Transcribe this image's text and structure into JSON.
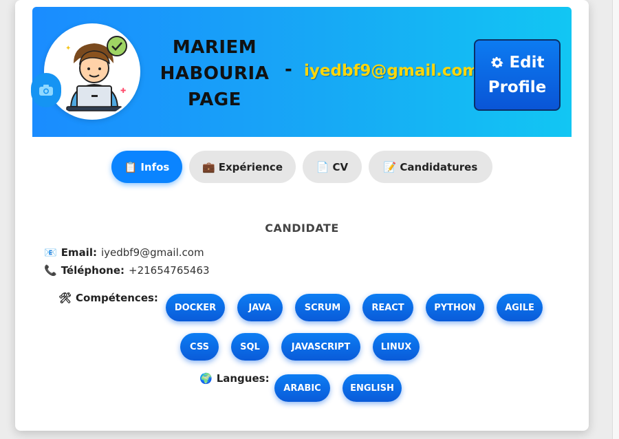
{
  "profile": {
    "name_line1": "MARIEM",
    "name_line2": "HABOURIA",
    "name_line3": "PAGE",
    "separator": "-",
    "email": "iyedbf9@gmail.com",
    "edit_line1": "Edit",
    "edit_line2": "Profile"
  },
  "tabs": [
    {
      "label": "Infos",
      "icon": "clipboard-icon",
      "active": true
    },
    {
      "label": "Expérience",
      "icon": "briefcase-icon",
      "active": false
    },
    {
      "label": "CV",
      "icon": "document-icon",
      "active": false
    },
    {
      "label": "Candidatures",
      "icon": "memo-icon",
      "active": false
    }
  ],
  "info": {
    "role": "CANDIDATE",
    "email_label": "Email:",
    "email_value": "iyedbf9@gmail.com",
    "phone_label": "Téléphone:",
    "phone_value": "+21654765463",
    "skills_label": "Compétences:",
    "skills": [
      "DOCKER",
      "JAVA",
      "SCRUM",
      "REACT",
      "PYTHON",
      "AGILE",
      "CSS",
      "SQL",
      "JAVASCRIPT",
      "LINUX"
    ],
    "languages_label": "Langues:",
    "languages": [
      "ARABIC",
      "ENGLISH"
    ]
  },
  "colors": {
    "banner_start": "#1a8cff",
    "banner_end": "#12c6f3",
    "accent": "#0a84ff",
    "email_highlight": "#ffd60a"
  }
}
